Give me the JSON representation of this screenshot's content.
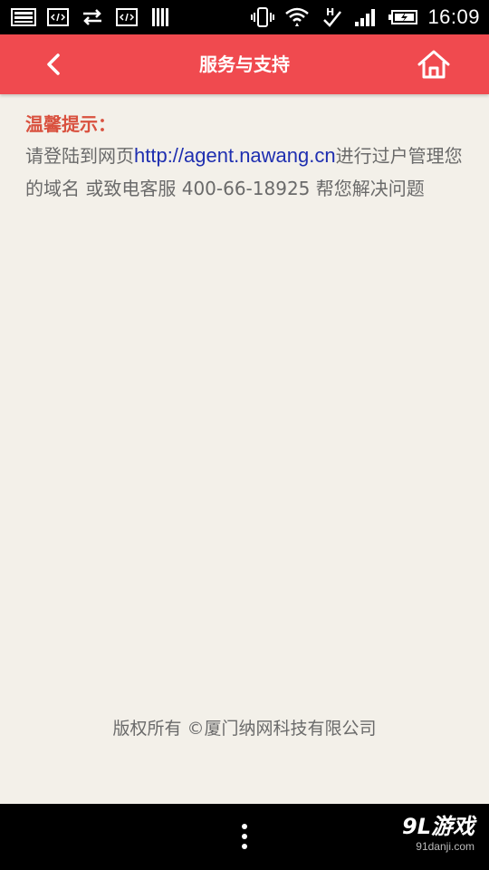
{
  "status_bar": {
    "time": "16:09",
    "left_icons": [
      "image-icon",
      "code-icon",
      "transfer-arrows-icon",
      "code-icon",
      "barcode-icon"
    ],
    "right_icons": [
      "vibrate-icon",
      "wifi-icon",
      "hspa-data-icon",
      "signal-icon",
      "battery-charging-icon"
    ],
    "network_type": "H"
  },
  "header": {
    "title": "服务与支持",
    "background": "#f04a4f",
    "left_icon": "chevron-left-icon",
    "right_icon": "home-icon"
  },
  "tip": {
    "title": "温馨提示：",
    "text_before_link": "请登陆到网页",
    "link": "http://agent.nawang.cn",
    "text_after_link": "进行过户管理您的域名 或致电客服 400-66-18925 帮您解决问题",
    "title_color": "#d9513f",
    "link_color": "#1f2fb0"
  },
  "footer": {
    "copyright": "版权所有 ©厦门纳网科技有限公司"
  },
  "nav_bar": {
    "menu_icon": "overflow-menu-icon",
    "watermark_logo": "9L游戏",
    "watermark_url": "91danji.com"
  }
}
